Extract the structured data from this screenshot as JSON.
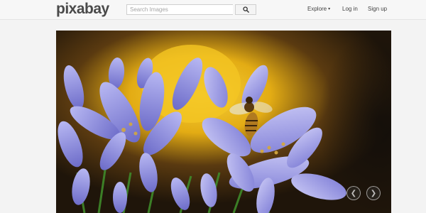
{
  "header": {
    "logo_text": "pixabay",
    "search": {
      "placeholder": "Search Images",
      "value": ""
    },
    "nav": {
      "explore_label": "Explore",
      "login_label": "Log in",
      "signup_label": "Sign up"
    }
  },
  "photo": {
    "icons": {
      "prev": "chevron-left-icon",
      "next": "chevron-right-icon",
      "search": "search-icon"
    },
    "colors": {
      "petals": "#8f8ee0",
      "background_glow": "#f2c21a",
      "dark_bg": "#2a1c10"
    }
  }
}
